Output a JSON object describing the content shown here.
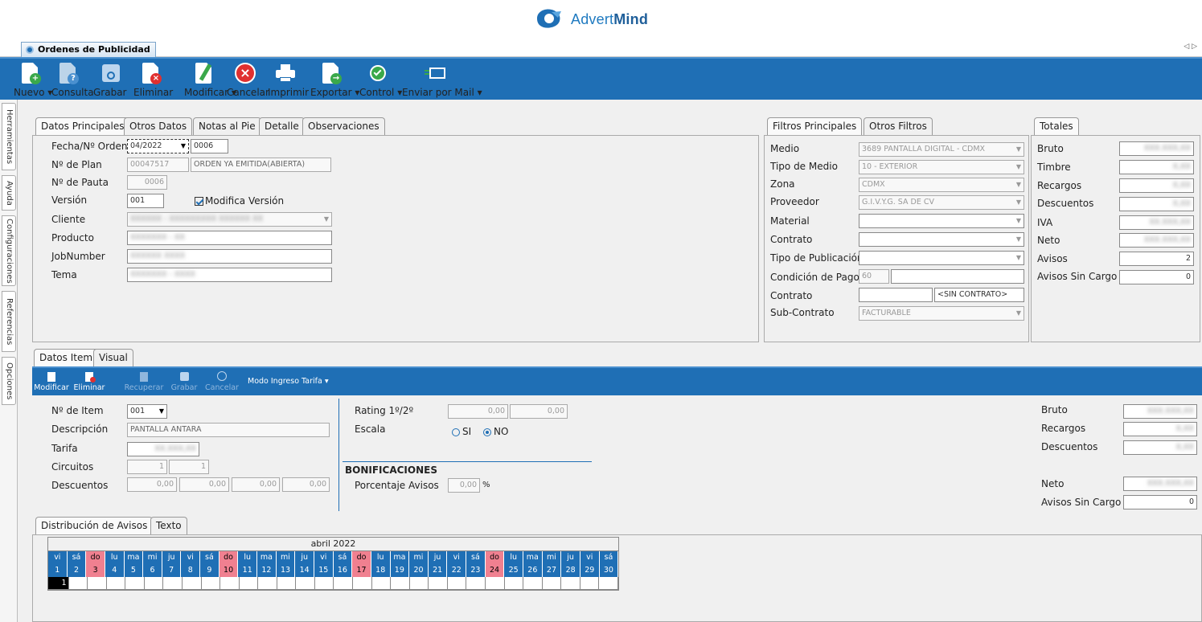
{
  "brand": {
    "name_part1": "Advert",
    "name_part2": "Mind",
    "color": "#1f6fb5"
  },
  "window": {
    "tab_title": "Ordenes de Publicidad",
    "nav_glyph": "◁ ▷"
  },
  "toolbar": {
    "nuevo": "Nuevo ▾",
    "consulta": "Consulta",
    "grabar": "Grabar",
    "eliminar": "Eliminar",
    "modificar": "Modificar ▾",
    "cancelar": "Cancelar",
    "imprimir": "Imprimir",
    "exportar": "Exportar ▾",
    "control": "Control ▾",
    "enviar": "Enviar por Mail ▾"
  },
  "sidebar": {
    "items": [
      "Herramientas",
      "Ayuda",
      "Configuraciones",
      "Referencias",
      "Opciones"
    ]
  },
  "main_tabs": [
    "Datos Principales",
    "Otros Datos",
    "Notas al Pie",
    "Detalle",
    "Observaciones"
  ],
  "main": {
    "fecha_label": "Fecha/Nº Orden",
    "fecha_value": "04/2022",
    "orden_value": "0006",
    "plan_label": "Nº de Plan",
    "plan_value": "00047517",
    "plan_status": "ORDEN YA EMITIDA(ABIERTA)",
    "pauta_label": "Nº de Pauta",
    "pauta_value": "0006",
    "version_label": "Versión",
    "version_value": "001",
    "modifica_version": "Modifica Versión",
    "cliente_label": "Cliente",
    "cliente_value": "XXXXXX - XXXXXXXXX XXXXXX XX",
    "producto_label": "Producto",
    "producto_value": "XXXXXXX - XX",
    "jobnumber_label": "JobNumber",
    "jobnumber_value": "XXXXXX XXXX",
    "tema_label": "Tema",
    "tema_value": "XXXXXXX - XXXX"
  },
  "filter_tabs": [
    "Filtros Principales",
    "Otros Filtros"
  ],
  "filters": {
    "medio_label": "Medio",
    "medio_value": "3689 PANTALLA DIGITAL - CDMX",
    "tipo_medio_label": "Tipo de Medio",
    "tipo_medio_value": "10 - EXTERIOR",
    "zona_label": "Zona",
    "zona_value": "CDMX",
    "proveedor_label": "Proveedor",
    "proveedor_value": "G.I.V.Y.G. SA DE CV",
    "material_label": "Material",
    "material_value": "",
    "contrato_label": "Contrato",
    "contrato_value": "",
    "tipo_pub_label": "Tipo de Publicación",
    "tipo_pub_value": "",
    "condicion_label": "Condición de Pago",
    "condicion_value": "60",
    "contrato2_label": "Contrato",
    "contrato2_value": "<SIN CONTRATO>",
    "subcontrato_label": "Sub-Contrato",
    "subcontrato_value": "FACTURABLE"
  },
  "totals_tab": "Totales",
  "totals": {
    "bruto_label": "Bruto",
    "bruto_value": "XXX.XXX,XX",
    "timbre_label": "Timbre",
    "timbre_value": "X,XX",
    "recargos_label": "Recargos",
    "recargos_value": "X,XX",
    "descuentos_label": "Descuentos",
    "descuentos_value": "X,XX",
    "iva_label": "IVA",
    "iva_value": "XX.XXX,XX",
    "neto_label": "Neto",
    "neto_value": "XXX.XXX,XX",
    "avisos_label": "Avisos",
    "avisos_value": "2",
    "sin_cargo_label": "Avisos Sin Cargo",
    "sin_cargo_value": "0"
  },
  "item_tabs": [
    "Datos Item",
    "Visual"
  ],
  "item_toolbar": {
    "modificar": "Modificar",
    "eliminar": "Eliminar",
    "recuperar": "Recuperar",
    "grabar": "Grabar",
    "cancelar": "Cancelar",
    "modo": "Modo Ingreso Tarifa ▾"
  },
  "item": {
    "nro_label": "Nº de Item",
    "nro_value": "001",
    "desc_label": "Descripción",
    "desc_value": "PANTALLA ANTARA",
    "tarifa_label": "Tarifa",
    "tarifa_value": "XX.XXX,XX",
    "circuitos_label": "Circuitos",
    "circuitos_1": "1",
    "circuitos_2": "1",
    "descuentos_label": "Descuentos",
    "desc_1": "0,00",
    "desc_2": "0,00",
    "desc_3": "0,00",
    "desc_4": "0,00",
    "rating_label": "Rating 1º/2º",
    "rating_1": "0,00",
    "rating_2": "0,00",
    "escala_label": "Escala",
    "escala_si": "SI",
    "escala_no": "NO",
    "bonif_title": "BONIFICACIONES",
    "porc_label": "Porcentaje Avisos",
    "porc_value": "0,00",
    "porc_unit": "%",
    "bruto_label": "Bruto",
    "bruto_value": "XXX.XXX,XX",
    "recargos_label": "Recargos",
    "recargos_value": "X,XX",
    "descuentos_tot_label": "Descuentos",
    "descuentos_tot_value": "X,XX",
    "neto_label": "Neto",
    "neto_value": "XXX.XXX,XX",
    "sin_cargo_label": "Avisos Sin Cargo",
    "sin_cargo_value": "0"
  },
  "dist_tabs": [
    "Distribución de Avisos",
    "Texto"
  ],
  "calendar": {
    "month": "abril 2022",
    "weekdays": [
      "vi",
      "sá",
      "do",
      "lu",
      "ma",
      "mi",
      "ju",
      "vi",
      "sá",
      "do",
      "lu",
      "ma",
      "mi",
      "ju",
      "vi",
      "sá",
      "do",
      "lu",
      "ma",
      "mi",
      "ju",
      "vi",
      "sá",
      "do",
      "lu",
      "ma",
      "mi",
      "ju",
      "vi",
      "sá"
    ],
    "days": [
      "1",
      "2",
      "3",
      "4",
      "5",
      "6",
      "7",
      "8",
      "9",
      "10",
      "11",
      "12",
      "13",
      "14",
      "15",
      "16",
      "17",
      "18",
      "19",
      "20",
      "21",
      "22",
      "23",
      "24",
      "25",
      "26",
      "27",
      "28",
      "29",
      "30"
    ],
    "sundays": [
      2,
      9,
      16,
      23
    ],
    "counts": [
      "1",
      "",
      "",
      "",
      "",
      "",
      "",
      "",
      "",
      "",
      "",
      "",
      "",
      "",
      "",
      "",
      "",
      "",
      "",
      "",
      "",
      "",
      "",
      "",
      "",
      "",
      "",
      "",
      "",
      ""
    ],
    "selected_index": 0,
    "header_color": "#1f6fb5",
    "sunday_color": "#f08090"
  }
}
